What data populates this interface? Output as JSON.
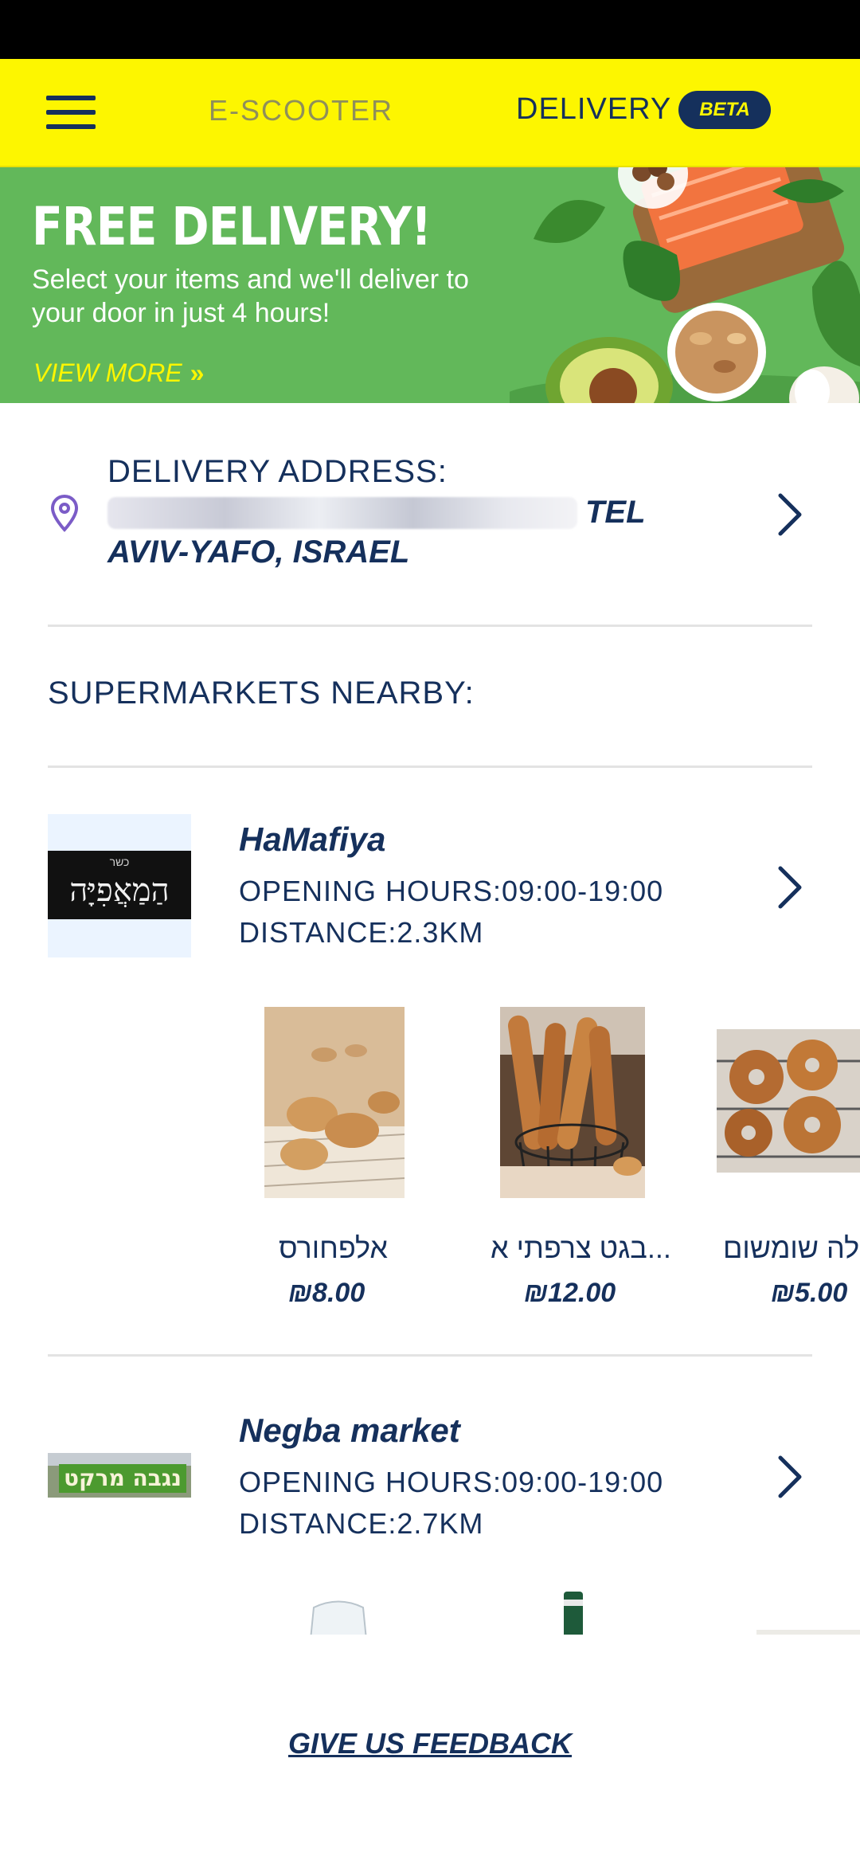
{
  "header": {
    "tab_escooter": "E-SCOOTER",
    "tab_delivery": "DELIVERY",
    "beta_badge": "BETA"
  },
  "banner": {
    "title": "FREE DELIVERY!",
    "subtitle": "Select your items and we'll deliver to your door in just 4 hours!",
    "view_more": "VIEW MORE",
    "view_more_icon": "double-chevron-right-icon"
  },
  "address": {
    "label": "DELIVERY ADDRESS:",
    "value": "TEL AVIV-YAFO, ISRAEL",
    "value_line1": "TEL",
    "value_line2": "AVIV-YAFO, ISRAEL",
    "icon": "location-pin-icon"
  },
  "nearby": {
    "title": "SUPERMARKETS NEARBY:"
  },
  "stores": [
    {
      "name": "HaMafiya",
      "hours": "OPENING HOURS:09:00-19:00",
      "distance": "DISTANCE:2.3KM",
      "logo_text": "הַמַאֲפִיָּה",
      "logo_small": "כשר",
      "products": [
        {
          "name": "אלפחורס",
          "price": "₪8.00"
        },
        {
          "name": "בגט צרפתי א...",
          "price": "₪12.00"
        },
        {
          "name": "לה שומשום",
          "price": "₪5.00"
        }
      ]
    },
    {
      "name": "Negba market",
      "hours": "OPENING HOURS:09:00-19:00",
      "distance": "DISTANCE:2.7KM",
      "logo_text": "נגבה מרקט"
    }
  ],
  "footer": {
    "feedback": "GIVE US FEEDBACK"
  },
  "colors": {
    "brand_yellow": "#fdf600",
    "navy": "#15305c",
    "banner_green": "#62b85a",
    "pin_purple": "#7b5cc7"
  }
}
